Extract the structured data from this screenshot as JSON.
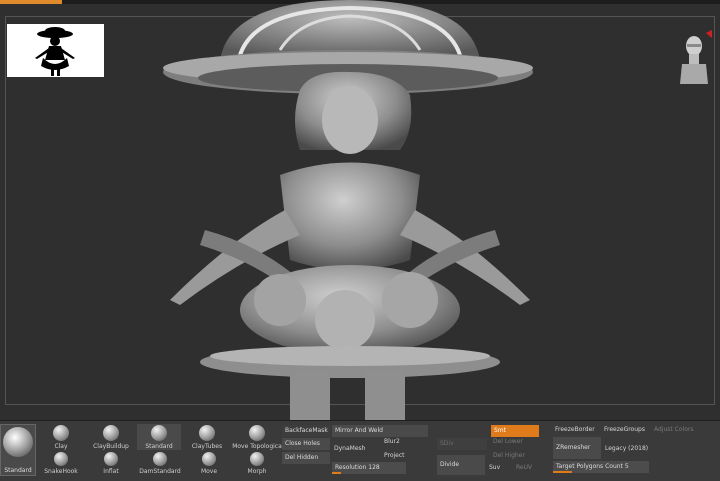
{
  "colors": {
    "accent": "#e07b1c",
    "viewport_bg": "#2f2f2f",
    "shelf_bg": "#3a3a3a"
  },
  "brushes": {
    "current": "Standard",
    "row1": [
      "Clay",
      "ClayBuildup",
      "Standard",
      "ClayTubes",
      "Move Topologica",
      "Move Topological"
    ],
    "row2": [
      "SnakeHook",
      "Inflat",
      "DamStandard",
      "Move",
      "Morph"
    ]
  },
  "masking": {
    "backface": "BackfaceMask",
    "close_holes": "Close Holes",
    "del_hidden": "Del Hidden"
  },
  "dynamesh": {
    "mirror_weld": "Mirror And Weld",
    "dynamesh": "DynaMesh",
    "blur": "Blur",
    "blur_value": "2",
    "project": "Project",
    "resolution_label": "Resolution",
    "resolution": "128",
    "resolution_fraction": 0.12
  },
  "subdivide": {
    "divide": "Divide",
    "smt": "Smt",
    "suv": "Suv",
    "reuv": "ReUV",
    "del_lower": "Del Lower",
    "del_higher": "Del Higher",
    "sdiv": "SDiv"
  },
  "remesh": {
    "freeze_border": "FreezeBorder",
    "freeze_groups": "FreezeGroups",
    "adjust_colors": "Adjust Colors",
    "zremesher": "ZRemesher",
    "legacy": "Legacy (2018)",
    "target_label": "Target Polygons Count",
    "target_value": "5",
    "target_fraction": 0.2
  }
}
